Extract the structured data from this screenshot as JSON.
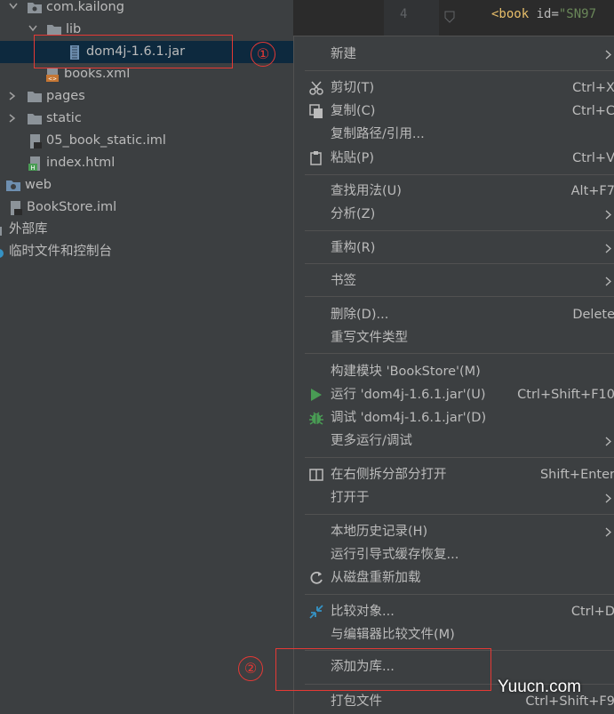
{
  "tree": {
    "items": [
      {
        "label": "com.kailong"
      },
      {
        "label": "lib"
      },
      {
        "label": "dom4j-1.6.1.jar"
      },
      {
        "label": "books.xml"
      },
      {
        "label": "pages"
      },
      {
        "label": "static"
      },
      {
        "label": "05_book_static.iml"
      },
      {
        "label": "index.html"
      },
      {
        "label": "web"
      },
      {
        "label": "BookStore.iml"
      },
      {
        "label": "外部库"
      },
      {
        "label": "临时文件和控制台"
      }
    ]
  },
  "editor": {
    "line_number": "4",
    "code_tag": "<book",
    "code_attr": " id=",
    "code_value": "\"SN97"
  },
  "menu": {
    "items": [
      {
        "label": "新建",
        "shortcut": ""
      },
      {
        "label": "剪切(T)",
        "shortcut": "Ctrl+X"
      },
      {
        "label": "复制(C)",
        "shortcut": "Ctrl+C"
      },
      {
        "label": "复制路径/引用...",
        "shortcut": ""
      },
      {
        "label": "粘贴(P)",
        "shortcut": "Ctrl+V"
      },
      {
        "label": "查找用法(U)",
        "shortcut": "Alt+F7"
      },
      {
        "label": "分析(Z)",
        "shortcut": ""
      },
      {
        "label": "重构(R)",
        "shortcut": ""
      },
      {
        "label": "书签",
        "shortcut": ""
      },
      {
        "label": "删除(D)...",
        "shortcut": "Delete"
      },
      {
        "label": "重写文件类型",
        "shortcut": ""
      },
      {
        "label": "构建模块 'BookStore'(M)",
        "shortcut": ""
      },
      {
        "label": "运行 'dom4j-1.6.1.jar'(U)",
        "shortcut": "Ctrl+Shift+F10"
      },
      {
        "label": "调试 'dom4j-1.6.1.jar'(D)",
        "shortcut": ""
      },
      {
        "label": "更多运行/调试",
        "shortcut": ""
      },
      {
        "label": "在右侧拆分部分打开",
        "shortcut": "Shift+Enter"
      },
      {
        "label": "打开于",
        "shortcut": ""
      },
      {
        "label": "本地历史记录(H)",
        "shortcut": ""
      },
      {
        "label": "运行引导式缓存恢复...",
        "shortcut": ""
      },
      {
        "label": "从磁盘重新加载",
        "shortcut": ""
      },
      {
        "label": "比较对象...",
        "shortcut": "Ctrl+D"
      },
      {
        "label": "与编辑器比较文件(M)",
        "shortcut": ""
      },
      {
        "label": "添加为库...",
        "shortcut": ""
      },
      {
        "label": "打包文件",
        "shortcut": "Ctrl+Shift+F9"
      }
    ]
  },
  "annotations": {
    "marker1": "①",
    "marker2": "②"
  },
  "watermark": "Yuucn.com",
  "colors": {
    "background": "#3c3f41",
    "selection": "#0d293e",
    "highlight_red": "#e53935",
    "run_green": "#499c54",
    "folder": "#8c9399"
  }
}
